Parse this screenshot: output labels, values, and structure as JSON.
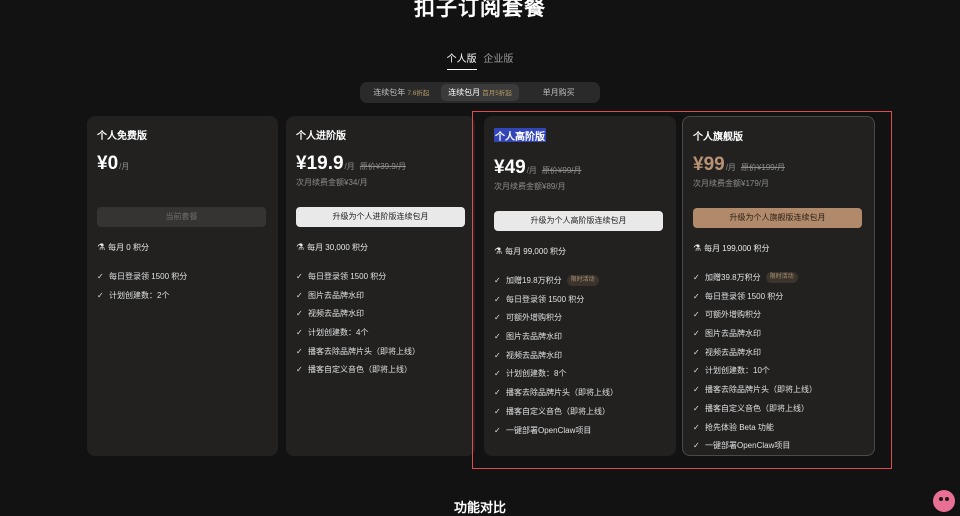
{
  "page": {
    "title": "扣子订阅套餐",
    "section_title": "功能对比"
  },
  "tabs": [
    {
      "label": "个人版",
      "active": true
    },
    {
      "label": "企业版",
      "active": false
    }
  ],
  "billing_options": [
    {
      "label": "连续包年",
      "discount": "7.6折起",
      "active": false
    },
    {
      "label": "连续包月",
      "discount": "首月5折起",
      "active": true
    },
    {
      "label": "单月购买",
      "discount": "",
      "active": false
    }
  ],
  "plans": [
    {
      "name": "个人免费版",
      "price": "¥0",
      "unit": "/月",
      "original": "",
      "renewal": "",
      "button": "当前套餐",
      "credits": "每月 0 积分",
      "features": [
        {
          "text": "每日登录领 1500 积分",
          "badge": ""
        },
        {
          "text": "计划创建数：2个",
          "badge": ""
        }
      ]
    },
    {
      "name": "个人进阶版",
      "price": "¥19.9",
      "unit": "/月",
      "original": "原价¥39.9/月",
      "renewal": "次月续费金额¥34/月",
      "button": "升级为个人进阶版连续包月",
      "credits": "每月 30,000 积分",
      "features": [
        {
          "text": "每日登录领 1500 积分",
          "badge": ""
        },
        {
          "text": "图片去品牌水印",
          "badge": ""
        },
        {
          "text": "视频去品牌水印",
          "badge": ""
        },
        {
          "text": "计划创建数：4个",
          "badge": ""
        },
        {
          "text": "播客去除品牌片头（即将上线）",
          "badge": ""
        },
        {
          "text": "播客自定义音色（即将上线）",
          "badge": ""
        }
      ]
    },
    {
      "name": "个人高阶版",
      "price": "¥49",
      "unit": "/月",
      "original": "原价¥99/月",
      "renewal": "次月续费金额¥89/月",
      "button": "升级为个人高阶版连续包月",
      "credits": "每月 99,000 积分",
      "features": [
        {
          "text": "加赠19.8万积分",
          "badge": "限时活动"
        },
        {
          "text": "每日登录领 1500 积分",
          "badge": ""
        },
        {
          "text": "可额外增购积分",
          "badge": ""
        },
        {
          "text": "图片去品牌水印",
          "badge": ""
        },
        {
          "text": "视频去品牌水印",
          "badge": ""
        },
        {
          "text": "计划创建数：8个",
          "badge": ""
        },
        {
          "text": "播客去除品牌片头（即将上线）",
          "badge": ""
        },
        {
          "text": "播客自定义音色（即将上线）",
          "badge": ""
        },
        {
          "text": "一键部署OpenClaw项目",
          "badge": ""
        }
      ]
    },
    {
      "name": "个人旗舰版",
      "price": "¥99",
      "unit": "/月",
      "original": "原价¥199/月",
      "renewal": "次月续费金额¥179/月",
      "button": "升级为个人旗舰版连续包月",
      "credits": "每月 199,000 积分",
      "features": [
        {
          "text": "加赠39.8万积分",
          "badge": "限时活动"
        },
        {
          "text": "每日登录领 1500 积分",
          "badge": ""
        },
        {
          "text": "可额外增购积分",
          "badge": ""
        },
        {
          "text": "图片去品牌水印",
          "badge": ""
        },
        {
          "text": "视频去品牌水印",
          "badge": ""
        },
        {
          "text": "计划创建数：10个",
          "badge": ""
        },
        {
          "text": "播客去除品牌片头（即将上线）",
          "badge": ""
        },
        {
          "text": "播客自定义音色（即将上线）",
          "badge": ""
        },
        {
          "text": "抢先体验 Beta 功能",
          "badge": ""
        },
        {
          "text": "一键部署OpenClaw项目",
          "badge": ""
        }
      ]
    }
  ],
  "icons": {
    "credits": "credits-chain-icon",
    "check": "check-icon",
    "mascot": "assistant-mascot-icon"
  },
  "colors": {
    "accent_gold": "#b08a6a",
    "highlight_frame": "#e04b52",
    "selection": "#3346b8",
    "background": "#121212"
  }
}
